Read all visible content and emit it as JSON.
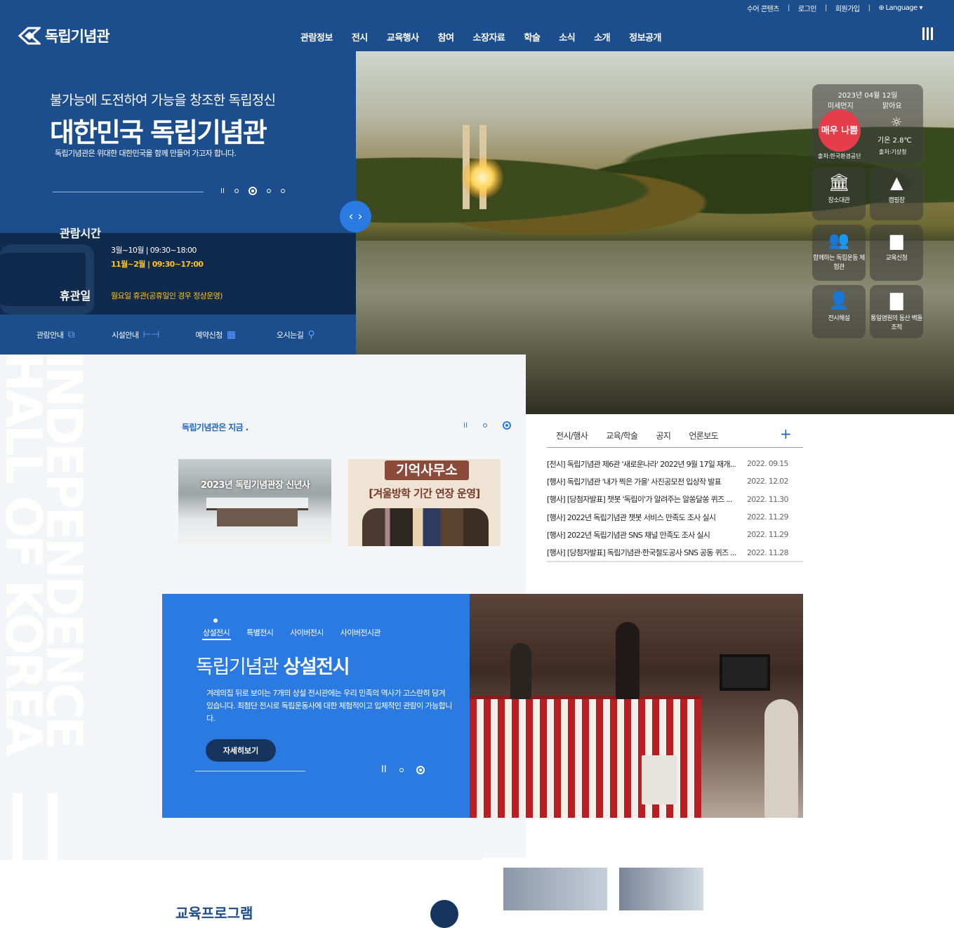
{
  "topbar": {
    "links": [
      "수어 콘텐츠",
      "로그인",
      "회원가입",
      "Language ▾"
    ]
  },
  "header": {
    "logo": "독립기념관",
    "nav": [
      "관람정보",
      "전시",
      "교육행사",
      "참여",
      "소장자료",
      "학술",
      "소식",
      "소개",
      "정보공개"
    ]
  },
  "hero": {
    "subtitle": "불가능에 도전하여 가능을 창조한 독립정신",
    "title": "대한민국 독립기념관",
    "desc": "독립기념관은 위대한 대한민국을 함께 만들어 가고자 합니다.",
    "pause": "II",
    "arrows": "‹ ›"
  },
  "hours": {
    "label": "관람시간",
    "row1": "3월~10월 | 09:30~18:00",
    "row2": "11월~2월 | 09:30~17:00",
    "closed_label": "휴관일",
    "closed_text": "월요일 휴관(공휴일인 경우 정상운영)"
  },
  "quick": [
    {
      "label": "관람안내",
      "icon": "⧉"
    },
    {
      "label": "시설안내",
      "icon": "⊢⊣"
    },
    {
      "label": "예약신청",
      "icon": "▦"
    },
    {
      "label": "오시는길",
      "icon": "⚲"
    }
  ],
  "weather": {
    "date": "2023년 04월 12일",
    "dust_label": "미세먼지",
    "sky": "맑아요",
    "dust_level": "매우 나쁨",
    "temp": "기온 2.8℃",
    "src1": "출처:한국환경공단",
    "src2": "출처:기상청",
    "tiles": [
      {
        "label": "장소대관",
        "icon": "🏛"
      },
      {
        "label": "캠핑장",
        "icon": "▲"
      },
      {
        "label": "함께하는 독립운동 체험관",
        "icon": "👥"
      },
      {
        "label": "교육신청",
        "icon": "▆"
      },
      {
        "label": "전시해설",
        "icon": "👤"
      },
      {
        "label": "통일염원의 동산 벽돌조적",
        "icon": "▇"
      }
    ]
  },
  "side_text": "INDEPENDENCE HALL OF KOREA",
  "now": {
    "title": "독립기념관은 지금 .",
    "pause": "II",
    "card1_caption": "2023년 독립기념관장 신년사",
    "card2_title": "기억사무소",
    "card2_sub": "[겨울방학 기간 연장 운영]"
  },
  "news": {
    "tabs": [
      "전시/행사",
      "교육/학술",
      "공지",
      "언론보도"
    ],
    "plus": "+",
    "items": [
      {
        "title": "[전시] 독립기념관 제6관 '새로운나라' 2022년 9월 17일 재개...",
        "date": "2022. 09.15"
      },
      {
        "title": "[행사] 독립기념관 '내가 찍은 가을' 사진공모전 입상작 발표",
        "date": "2022. 12.02"
      },
      {
        "title": "[행사] [당첨자발표] 챗봇 '독립이'가 알려주는 알쏭달쏭 퀴즈 ...",
        "date": "2022. 11.30"
      },
      {
        "title": "[행사] 2022년 독립기념관 챗봇 서비스 만족도 조사 실시",
        "date": "2022. 11.29"
      },
      {
        "title": "[행사] 2022년 독립기념관 SNS 채널 만족도 조사 실시",
        "date": "2022. 11.29"
      },
      {
        "title": "[행사] [당첨자발표] 독립기념관·한국철도공사 SNS 공동 퀴즈 ...",
        "date": "2022. 11.28"
      }
    ]
  },
  "exhibition": {
    "tabs": [
      "상설전시",
      "특별전시",
      "사이버전시",
      "사이버전시관"
    ],
    "title_light": "독립기념관 ",
    "title_bold": "상설전시",
    "desc": "겨레의집 뒤로 보이는 7개의 상설 전시관에는 우리 민족의 역사가 고스란히 담겨 있습니다. 최첨단 전시로 독립운동사에 대한 체험적이고 입체적인 관람이 가능합니다.",
    "button": "자세히보기",
    "pause": "II"
  },
  "bottom": {
    "title": "교육프로그램"
  },
  "colors": {
    "navy": "#1c4d8c",
    "dark": "#102a4d",
    "blue": "#2a7ae2",
    "yellow": "#ffc21a",
    "red": "#e53d4a"
  }
}
